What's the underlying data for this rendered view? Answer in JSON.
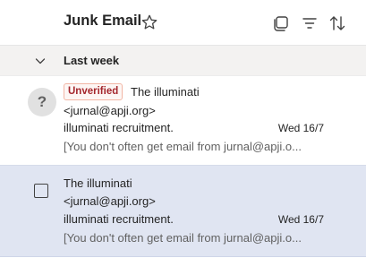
{
  "header": {
    "title": "Junk Email",
    "icons": {
      "favorite": "star-icon",
      "select": "select-mode-icon",
      "filter": "filter-icon",
      "sort": "sort-icon"
    }
  },
  "group": {
    "label": "Last week",
    "chevron": "chevron-down-icon"
  },
  "messages": [
    {
      "avatar": "?",
      "badge": "Unverified",
      "sender": "The illuminati",
      "email": "<jurnal@apji.org>",
      "subject": "illuminati recruitment.",
      "date": "Wed 16/7",
      "preview": "[You don't often get email from jurnal@apji.o..."
    },
    {
      "sender": "The illuminati",
      "email": "<jurnal@apji.org>",
      "subject": "illuminati recruitment.",
      "date": "Wed 16/7",
      "preview": "[You don't often get email from jurnal@apji.o..."
    }
  ],
  "colors": {
    "selected_row": "#e0e5f2",
    "group_bg": "#f3f2f1",
    "badge_text": "#a4262c",
    "badge_border": "#f2b6a5"
  }
}
